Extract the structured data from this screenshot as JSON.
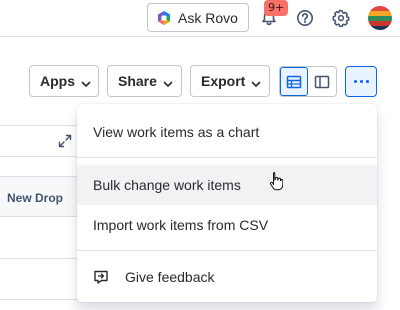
{
  "topbar": {
    "ask_rovo_label": "Ask Rovo",
    "notification_badge": "9+"
  },
  "toolbar": {
    "apps_label": "Apps",
    "share_label": "Share",
    "export_label": "Export"
  },
  "table": {
    "column_header": "New Drop"
  },
  "menu": {
    "items": [
      {
        "label": "View work items as a chart"
      },
      {
        "label": "Bulk change work items"
      },
      {
        "label": "Import work items from CSV"
      },
      {
        "label": "Give feedback",
        "icon": "feedback-icon"
      }
    ]
  },
  "colors": {
    "accent": "#0c66e4",
    "accent_bg": "#e9f2ff",
    "badge": "#f87168",
    "border": "#c1c7d0",
    "hover": "#f1f2f4"
  }
}
